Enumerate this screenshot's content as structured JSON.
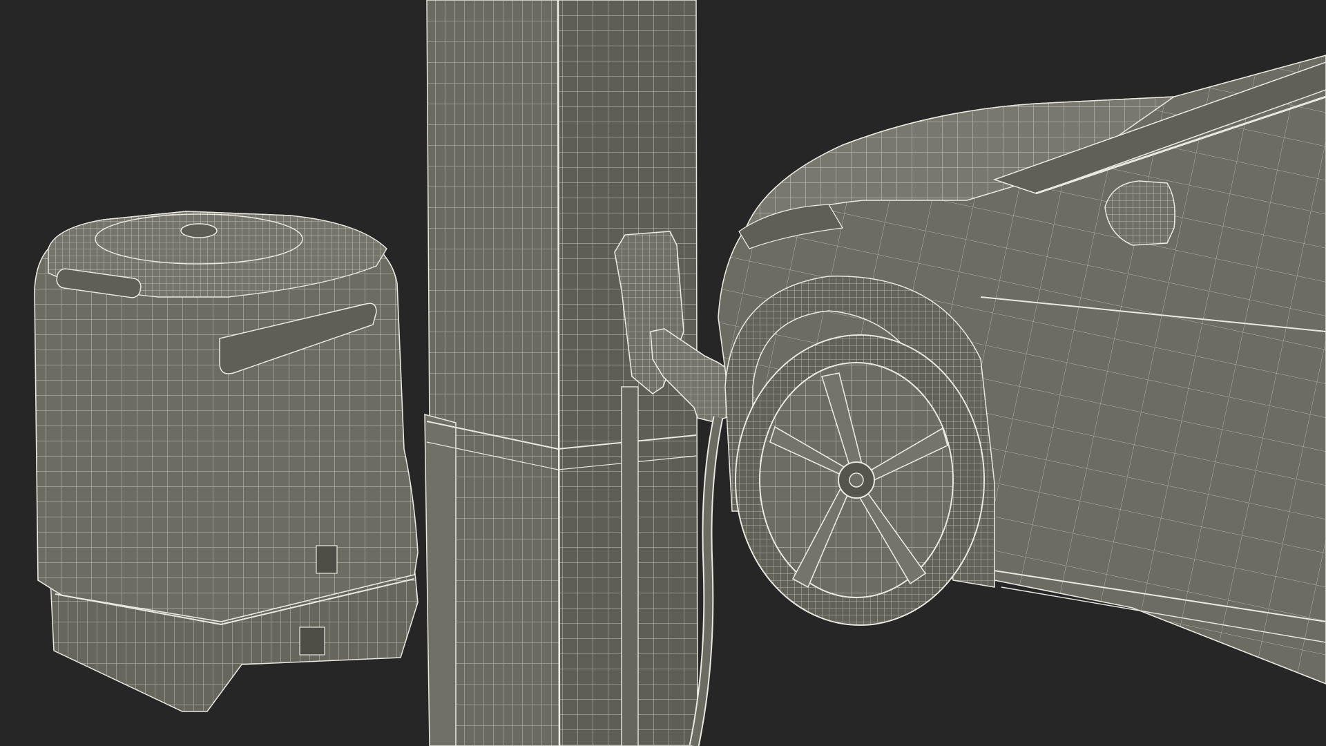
{
  "scene": {
    "background_color": "#262626",
    "surface_color": "#6c6c62",
    "surface_shade_color": "#5f5f56",
    "wire_color": "#e9e9e2",
    "objects": [
      {
        "name": "battery-unit",
        "label": ""
      },
      {
        "name": "charging-pillar",
        "label": ""
      },
      {
        "name": "charging-handle",
        "label": ""
      },
      {
        "name": "charging-cable",
        "label": ""
      },
      {
        "name": "electric-car-front",
        "label": ""
      },
      {
        "name": "front-wheel",
        "label": ""
      }
    ]
  }
}
